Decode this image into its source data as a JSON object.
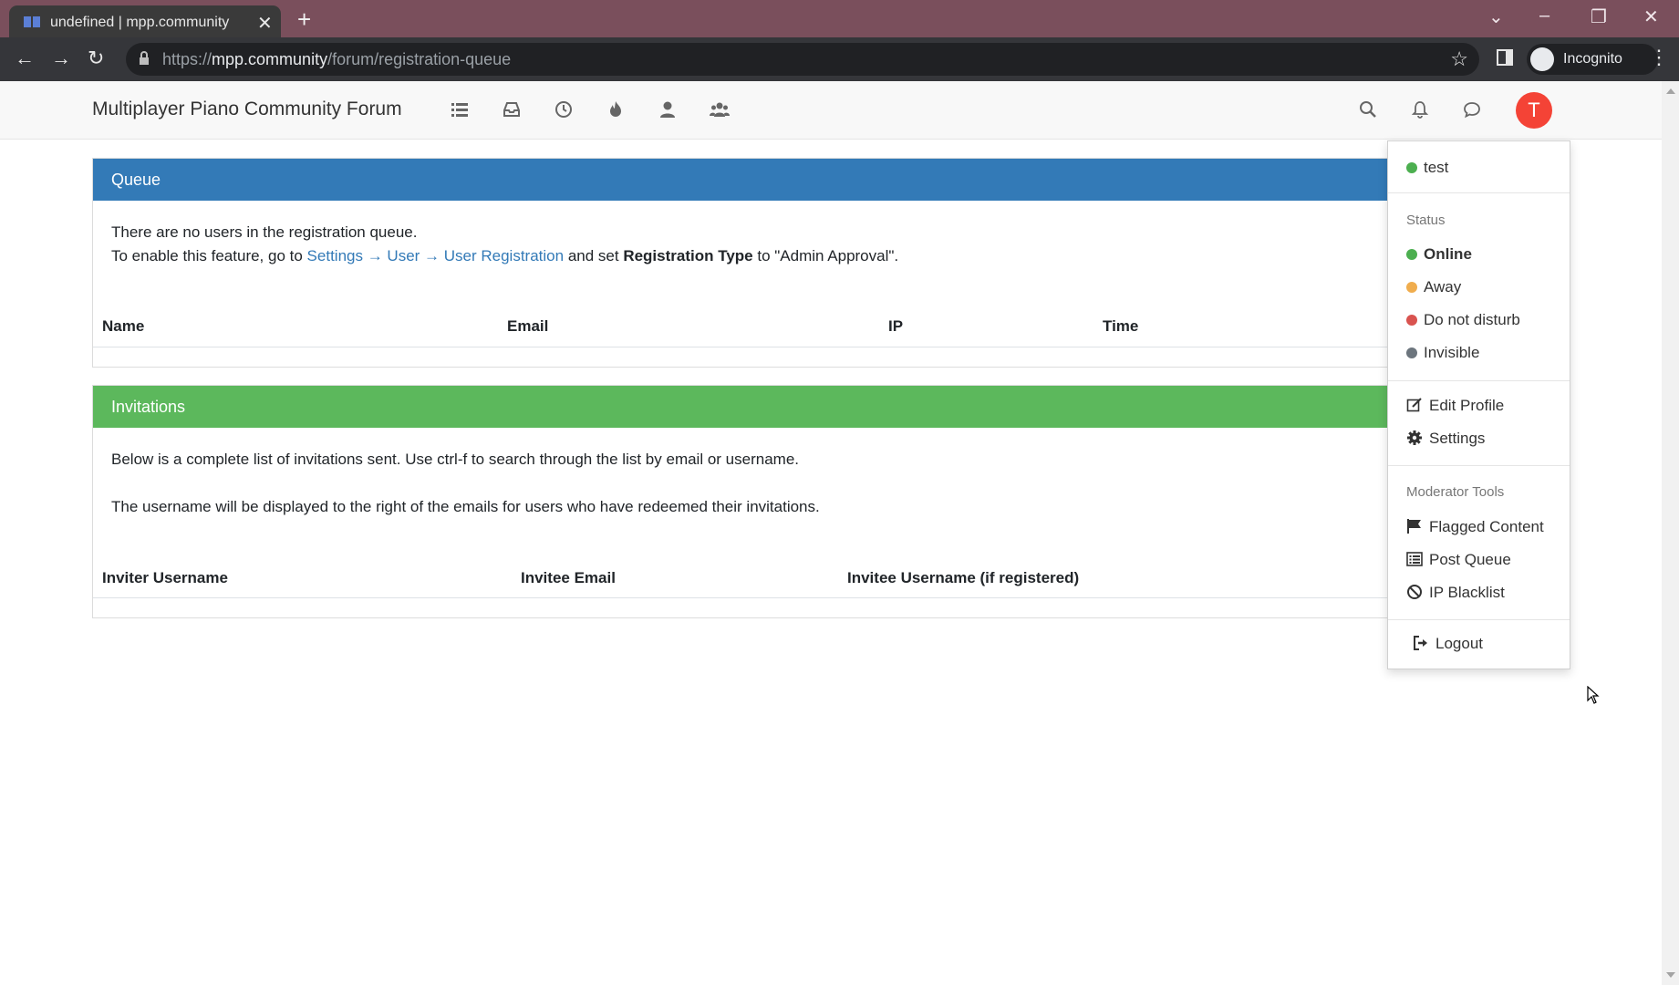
{
  "browser": {
    "tab_title": "undefined | mpp.community",
    "new_tab": "+",
    "tab_close": "✕",
    "url_scheme": "https://",
    "url_host": "mpp.community",
    "url_path": "/forum/registration-queue",
    "profile_label": "Incognito",
    "window_controls": {
      "dropdown": "⌄",
      "minimize": "–",
      "restore": "❐",
      "close": "✕"
    },
    "nav": {
      "back": "←",
      "forward": "→",
      "reload": "↻",
      "star": "☆",
      "menu": "⋮"
    }
  },
  "header": {
    "brand": "Multiplayer Piano Community Forum",
    "avatar_letter": "T",
    "icons": [
      "list-icon",
      "inbox-icon",
      "clock-icon",
      "fire-icon",
      "user-icon",
      "users-icon",
      "search-icon",
      "bell-icon",
      "chat-icon"
    ]
  },
  "queue": {
    "heading": "Queue",
    "empty_text": "There are no users in the registration queue.",
    "enable_prefix": "To enable this feature, go to ",
    "enable_link": "Settings → User → User Registration",
    "enable_mid": " and set ",
    "enable_bold": "Registration Type",
    "enable_suffix": " to \"Admin Approval\".",
    "columns": [
      "Name",
      "Email",
      "IP",
      "Time"
    ]
  },
  "invitations": {
    "heading": "Invitations",
    "line1": "Below is a complete list of invitations sent. Use ctrl-f to search through the list by email or username.",
    "line2": "The username will be displayed to the right of the emails for users who have redeemed their invitations.",
    "columns": [
      "Inviter Username",
      "Invitee Email",
      "Invitee Username (if registered)"
    ]
  },
  "dropdown": {
    "username": "test",
    "status_header": "Status",
    "statuses": [
      {
        "label": "Online",
        "color": "#4caf50",
        "active": true
      },
      {
        "label": "Away",
        "color": "#f0ad4e",
        "active": false
      },
      {
        "label": "Do not disturb",
        "color": "#d9534f",
        "active": false
      },
      {
        "label": "Invisible",
        "color": "#6c757d",
        "active": false
      }
    ],
    "edit_profile": "Edit Profile",
    "settings": "Settings",
    "mod_header": "Moderator Tools",
    "flagged": "Flagged Content",
    "post_queue": "Post Queue",
    "ip_blacklist": "IP Blacklist",
    "logout": "Logout"
  },
  "colors": {
    "queue_heading": "#337ab7",
    "invitations_heading": "#5cb85c",
    "link": "#337ab7",
    "avatar": "#f44336",
    "tabbar": "#7a4f5c"
  }
}
